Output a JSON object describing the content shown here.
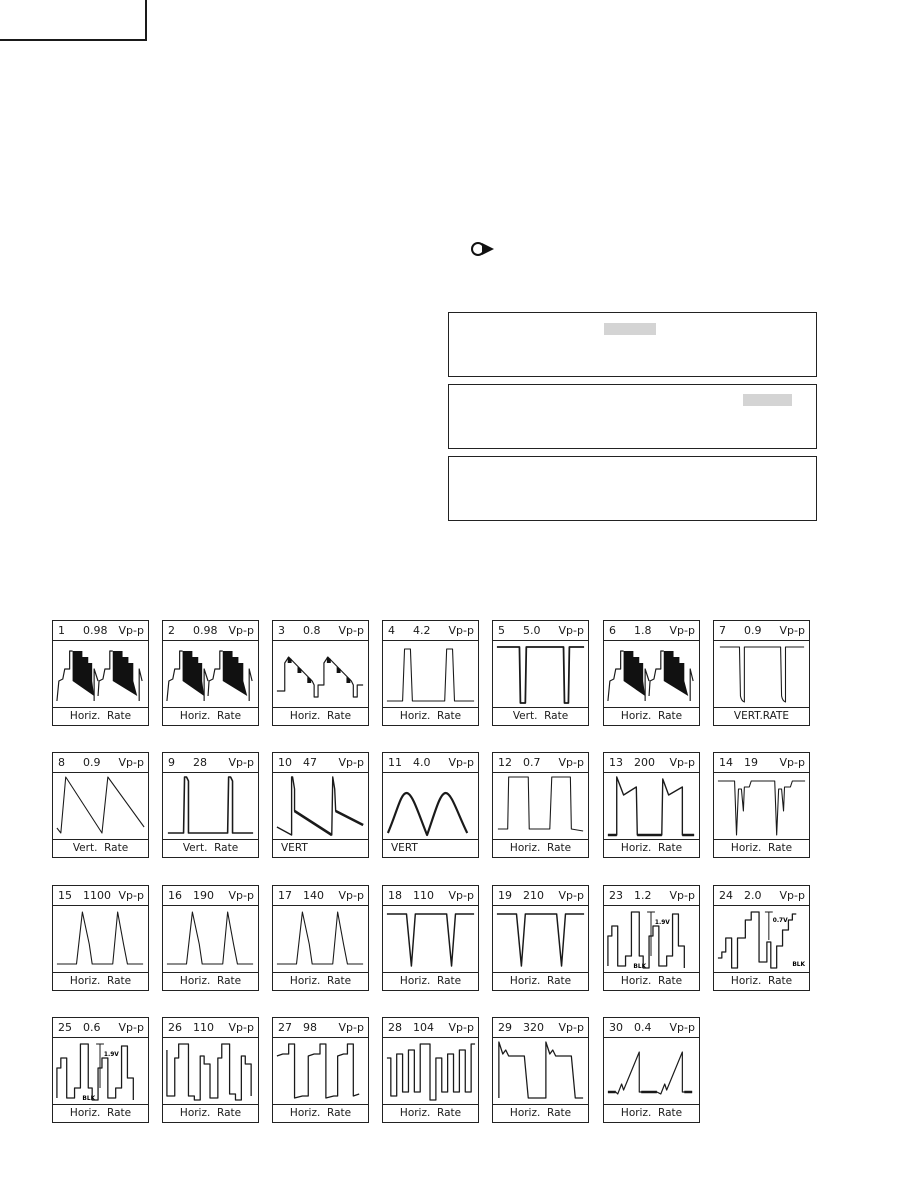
{
  "page": {
    "corner_tab_text": "",
    "pointer_icon": "circle-pointer-arrow-icon",
    "note_boxes": [
      {
        "text": "",
        "redacted": true
      },
      {
        "text": "",
        "redacted": true
      },
      {
        "text": "",
        "redacted": false
      }
    ]
  },
  "waveforms": [
    {
      "id": "1",
      "value": "0.98",
      "unit": "Vp-p",
      "rate": "Horiz.  Rate",
      "shape": "video-staircase-filled"
    },
    {
      "id": "2",
      "value": "0.98",
      "unit": "Vp-p",
      "rate": "Horiz.  Rate",
      "shape": "video-staircase-filled"
    },
    {
      "id": "3",
      "value": "0.8",
      "unit": "Vp-p",
      "rate": "Horiz.  Rate",
      "shape": "video-staircase-open"
    },
    {
      "id": "4",
      "value": "4.2",
      "unit": "Vp-p",
      "rate": "Horiz.  Rate",
      "shape": "narrow-positive-pulse"
    },
    {
      "id": "5",
      "value": "5.0",
      "unit": "Vp-p",
      "rate": "Vert.  Rate",
      "shape": "narrow-negative-pulse"
    },
    {
      "id": "6",
      "value": "1.8",
      "unit": "Vp-p",
      "rate": "Horiz.  Rate",
      "shape": "video-staircase-filled"
    },
    {
      "id": "7",
      "value": "0.9",
      "unit": "Vp-p",
      "rate": "VERT.RATE",
      "shape": "negative-pulse-rounded"
    },
    {
      "id": "8",
      "value": "0.9",
      "unit": "Vp-p",
      "rate": "Vert.  Rate",
      "shape": "sawtooth-falling"
    },
    {
      "id": "9",
      "value": "28",
      "unit": "Vp-p",
      "rate": "Vert.  Rate",
      "shape": "positive-pulse-flat"
    },
    {
      "id": "10",
      "value": "47",
      "unit": "Vp-p",
      "rate": "VERT",
      "shape": "flyback-sawtooth"
    },
    {
      "id": "11",
      "value": "4.0",
      "unit": "Vp-p",
      "rate": "VERT",
      "shape": "parabola"
    },
    {
      "id": "12",
      "value": "0.7",
      "unit": "Vp-p",
      "rate": "Horiz.  Rate",
      "shape": "square-wave"
    },
    {
      "id": "13",
      "value": "200",
      "unit": "Vp-p",
      "rate": "Horiz.  Rate",
      "shape": "overshoot-square"
    },
    {
      "id": "14",
      "value": "19",
      "unit": "Vp-p",
      "rate": "Horiz.  Rate",
      "shape": "negative-spikes"
    },
    {
      "id": "15",
      "value": "1100",
      "unit": "Vp-p",
      "rate": "Horiz.  Rate",
      "shape": "flyback-pulse"
    },
    {
      "id": "16",
      "value": "190",
      "unit": "Vp-p",
      "rate": "Horiz.  Rate",
      "shape": "flyback-pulse"
    },
    {
      "id": "17",
      "value": "140",
      "unit": "Vp-p",
      "rate": "Horiz.  Rate",
      "shape": "flyback-pulse"
    },
    {
      "id": "18",
      "value": "110",
      "unit": "Vp-p",
      "rate": "Horiz.  Rate",
      "shape": "negative-v-pulse"
    },
    {
      "id": "19",
      "value": "210",
      "unit": "Vp-p",
      "rate": "Horiz.  Rate",
      "shape": "negative-v-pulse"
    },
    {
      "id": "23",
      "value": "1.2",
      "unit": "Vp-p",
      "rate": "Horiz.  Rate",
      "shape": "color-bar-steps",
      "annotations": [
        "1.9V",
        "BLK"
      ]
    },
    {
      "id": "24",
      "value": "2.0",
      "unit": "Vp-p",
      "rate": "Horiz.  Rate",
      "shape": "staircase-rising",
      "annotations": [
        "0.7V",
        "BLK"
      ]
    },
    {
      "id": "25",
      "value": "0.6",
      "unit": "Vp-p",
      "rate": "Horiz.  Rate",
      "shape": "color-bar-steps",
      "annotations": [
        "1.9V",
        "BLK"
      ]
    },
    {
      "id": "26",
      "value": "110",
      "unit": "Vp-p",
      "rate": "Horiz.  Rate",
      "shape": "stepped-square"
    },
    {
      "id": "27",
      "value": "98",
      "unit": "Vp-p",
      "rate": "Horiz.  Rate",
      "shape": "stepped-square-ringing"
    },
    {
      "id": "28",
      "value": "104",
      "unit": "Vp-p",
      "rate": "Horiz.  Rate",
      "shape": "varying-square"
    },
    {
      "id": "29",
      "value": "320",
      "unit": "Vp-p",
      "rate": "Horiz.  Rate",
      "shape": "wide-pulse-overshoot"
    },
    {
      "id": "30",
      "value": "0.4",
      "unit": "Vp-p",
      "rate": "Horiz.  Rate",
      "shape": "rising-ramp"
    }
  ]
}
